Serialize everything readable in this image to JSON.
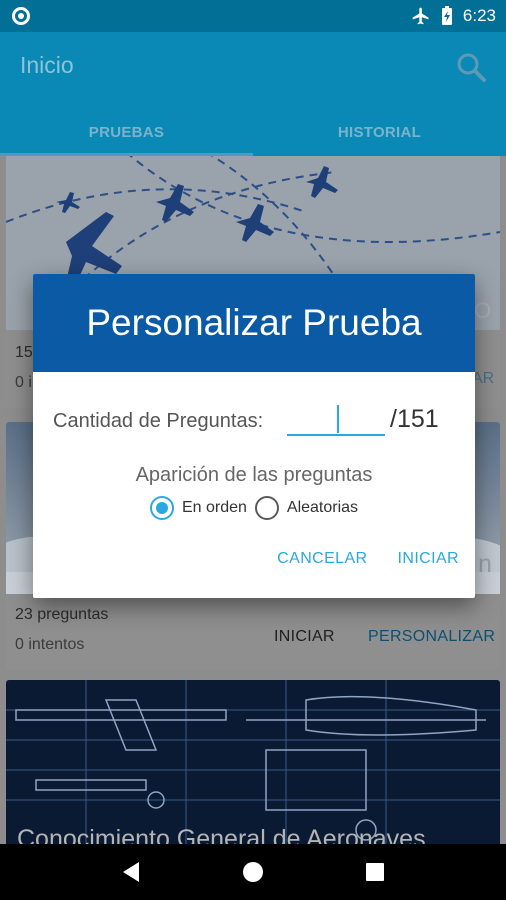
{
  "status_bar": {
    "time": "6:23",
    "icons": [
      "notification-circle-icon",
      "airplane-mode-icon",
      "battery-charging-icon"
    ]
  },
  "app_bar": {
    "title": "Inicio",
    "search_icon": "search-icon",
    "tabs": [
      {
        "label": "PRUEBAS",
        "active": true
      },
      {
        "label": "HISTORIAL",
        "active": false
      }
    ]
  },
  "cards": [
    {
      "questions_partial": "15",
      "attempts_partial": "0 i",
      "peek_right_top": "O",
      "peek_right_bottom": "AR"
    },
    {
      "questions": "23 preguntas",
      "attempts": "0 intentos",
      "start_label": "INICIAR",
      "customize_label": "PERSONALIZAR",
      "peek_title_right": "n"
    },
    {
      "title": "Conocimiento General de Aeronaves"
    }
  ],
  "dialog": {
    "title": "Personalizar Prueba",
    "quantity_label": "Cantidad de Preguntas:",
    "quantity_value": "",
    "quantity_total": "/151",
    "order_label": "Aparición de las preguntas",
    "options": [
      {
        "label": "En orden",
        "checked": true
      },
      {
        "label": "Aleatorias",
        "checked": false
      }
    ],
    "cancel_label": "CANCELAR",
    "start_label": "INICIAR"
  },
  "colors": {
    "status_bar": "#016f96",
    "app_bar": "#0a88b6",
    "dialog_header": "#0a5aa5",
    "accent": "#29a9e0"
  }
}
